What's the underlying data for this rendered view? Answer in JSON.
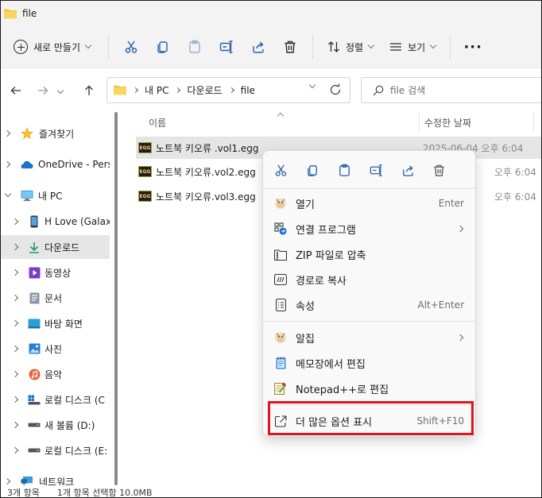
{
  "window": {
    "title": "file"
  },
  "toolbar": {
    "new_label": "새로 만들기",
    "sort_label": "정렬",
    "view_label": "보기"
  },
  "address": {
    "crumbs": [
      "내 PC",
      "다운로드",
      "file"
    ],
    "search_placeholder": "file 검색"
  },
  "sidebar": {
    "items": [
      {
        "label": "즐겨찾기",
        "icon": "star-icon"
      },
      {
        "label": "OneDrive - Perso",
        "icon": "cloud-icon"
      },
      {
        "label": "내 PC",
        "icon": "computer-icon"
      },
      {
        "label": "H Love (Galaxy",
        "icon": "phone-icon"
      },
      {
        "label": "다운로드",
        "icon": "download-icon"
      },
      {
        "label": "동영상",
        "icon": "video-icon"
      },
      {
        "label": "문서",
        "icon": "document-icon"
      },
      {
        "label": "바탕 화면",
        "icon": "desktop-icon"
      },
      {
        "label": "사진",
        "icon": "pictures-icon"
      },
      {
        "label": "음악",
        "icon": "music-icon"
      },
      {
        "label": "로컬 디스크 (C",
        "icon": "drive-c-icon"
      },
      {
        "label": "새 볼륨 (D:)",
        "icon": "drive-icon"
      },
      {
        "label": "로컬 디스크 (E:",
        "icon": "drive-icon"
      },
      {
        "label": "네트워크",
        "icon": "network-icon"
      }
    ]
  },
  "filelist": {
    "columns": {
      "name": "이름",
      "modified": "수정한 날짜"
    },
    "rows": [
      {
        "name": "노트북 키오류 .vol1.egg",
        "date": "2025-06-04 오후 6:04"
      },
      {
        "name": "노트북 키오류.vol2.egg",
        "date": "오후 6:04"
      },
      {
        "name": "노트북 키오류.vol3.egg",
        "date": "오후 6:04"
      }
    ],
    "file_icon_text": "EGG"
  },
  "context_menu": {
    "items": [
      {
        "label": "열기",
        "shortcut": "Enter",
        "icon": "alzip-icon"
      },
      {
        "label": "연결 프로그램",
        "shortcut": "",
        "icon": "open-with-icon"
      },
      {
        "label": "ZIP 파일로 압축",
        "shortcut": "",
        "icon": "zip-icon"
      },
      {
        "label": "경로로 복사",
        "shortcut": "",
        "icon": "copy-path-icon"
      },
      {
        "label": "속성",
        "shortcut": "Alt+Enter",
        "icon": "properties-icon"
      },
      {
        "label": "알집",
        "shortcut": "",
        "icon": "alzip-icon"
      },
      {
        "label": "메모장에서 편집",
        "shortcut": "",
        "icon": "notepad-icon"
      },
      {
        "label": "Notepad++로 편집",
        "shortcut": "",
        "icon": "notepadpp-icon"
      },
      {
        "label": "더 많은 옵션 표시",
        "shortcut": "Shift+F10",
        "icon": "more-options-icon"
      }
    ]
  },
  "status": {
    "count": "3개 항목",
    "selection": "1개 항목 선택함 10.0MB"
  },
  "colors": {
    "highlight": "#e0141c",
    "accent": "#0067c0",
    "folder": "#f7c84a"
  }
}
